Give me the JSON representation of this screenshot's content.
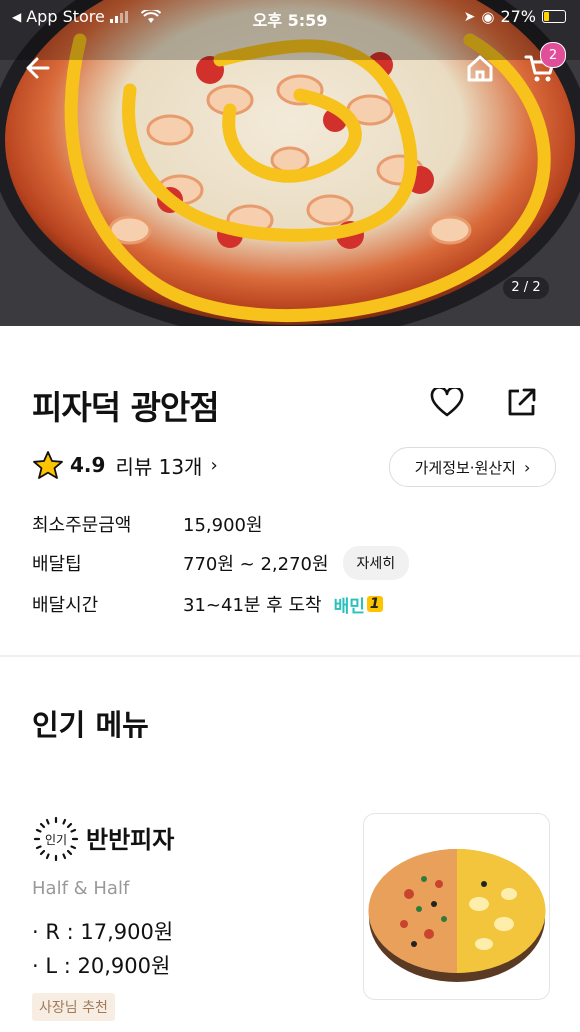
{
  "status_bar": {
    "back_app": "App Store",
    "time": "오후 5:59",
    "battery": "27%"
  },
  "hero": {
    "page_indicator": "2 / 2",
    "cart_count": "2"
  },
  "store": {
    "name": "피자덕 광안점",
    "rating": "4.9",
    "review_label": "리뷰 13개",
    "info_button": "가게정보·원산지"
  },
  "info": {
    "min_order_label": "최소주문금액",
    "min_order_value": "15,900원",
    "delivery_tip_label": "배달팁",
    "delivery_tip_value": "770원 ~ 2,270원",
    "detail_button": "자세히",
    "delivery_time_label": "배달시간",
    "delivery_time_value": "31~41분 후 도착",
    "baemin_label": "배민",
    "baemin_num": "1"
  },
  "popular": {
    "section_title": "인기 메뉴",
    "items": [
      {
        "badge": "인기",
        "name": "반반피자",
        "subtitle": "Half & Half",
        "prices": [
          "· R : 17,900원",
          "· L : 20,900원"
        ],
        "tag": "사장님 추천"
      }
    ]
  },
  "colors": {
    "accent_teal": "#2ac1bc",
    "badge_pink": "#e14e9a",
    "star_yellow": "#ffc400"
  }
}
